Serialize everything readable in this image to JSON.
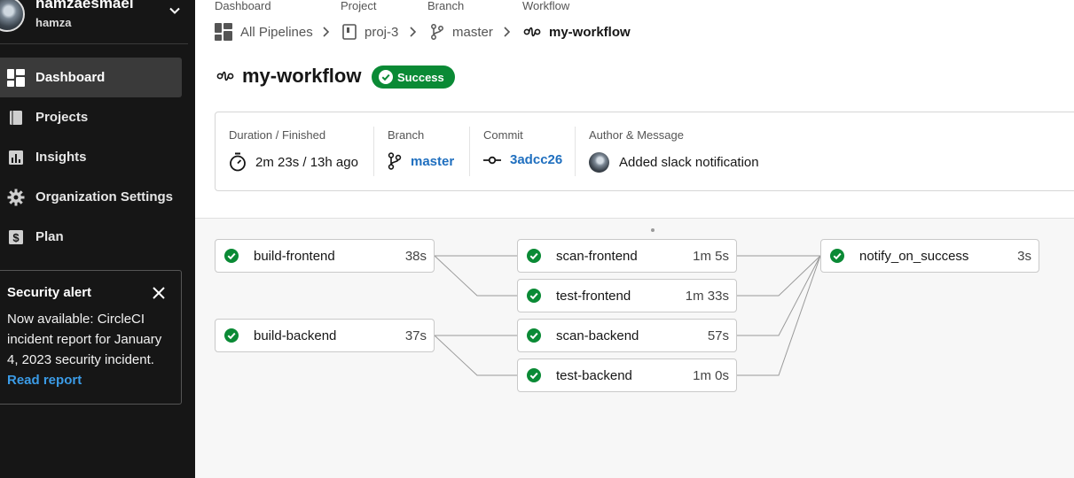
{
  "user": {
    "name": "hamzaesmael",
    "handle": "hamza"
  },
  "nav": [
    {
      "label": "Dashboard",
      "icon": "dashboard-icon",
      "active": true
    },
    {
      "label": "Projects",
      "icon": "book-icon"
    },
    {
      "label": "Insights",
      "icon": "bar-chart-icon"
    },
    {
      "label": "Organization Settings",
      "icon": "gear-icon"
    },
    {
      "label": "Plan",
      "icon": "dollar-icon"
    }
  ],
  "alert": {
    "title": "Security alert",
    "body": "Now available: CircleCI incident report for January 4, 2023 security incident.",
    "link": "Read report"
  },
  "breadcrumb": {
    "labels": [
      "Dashboard",
      "Project",
      "Branch",
      "Workflow"
    ],
    "items": [
      "All Pipelines",
      "proj-3",
      "master",
      "my-workflow"
    ]
  },
  "workflow": {
    "title": "my-workflow",
    "status": "Success",
    "status_color": "#0a8a35"
  },
  "info": {
    "duration_label": "Duration / Finished",
    "duration_value": "2m 23s / 13h ago",
    "branch_label": "Branch",
    "branch_value": "master",
    "commit_label": "Commit",
    "commit_value": "3adcc26",
    "author_label": "Author & Message",
    "author_message": "Added slack notification"
  },
  "jobs": [
    {
      "name": "build-frontend",
      "duration": "38s",
      "status": "success"
    },
    {
      "name": "build-backend",
      "duration": "37s",
      "status": "success"
    },
    {
      "name": "scan-frontend",
      "duration": "1m 5s",
      "status": "success"
    },
    {
      "name": "test-frontend",
      "duration": "1m 33s",
      "status": "success"
    },
    {
      "name": "scan-backend",
      "duration": "57s",
      "status": "success"
    },
    {
      "name": "test-backend",
      "duration": "1m 0s",
      "status": "success"
    },
    {
      "name": "notify_on_success",
      "duration": "3s",
      "status": "success"
    }
  ],
  "colors": {
    "sidebar": "#161616",
    "success": "#0a8a35",
    "link": "#1f6fbf",
    "alert_link": "#3b9be6"
  }
}
